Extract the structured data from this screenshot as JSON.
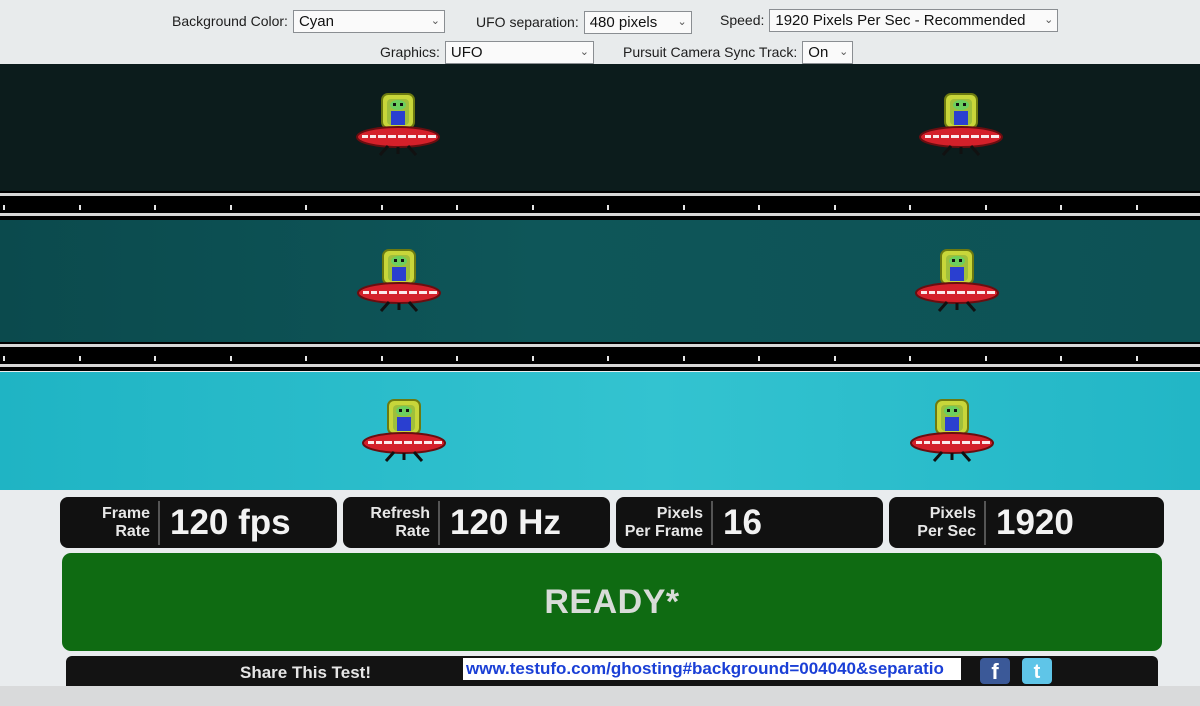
{
  "controls": {
    "background_color": {
      "label": "Background Color:",
      "value": "Cyan"
    },
    "ufo_separation": {
      "label": "UFO separation:",
      "value": "480 pixels"
    },
    "speed": {
      "label": "Speed:",
      "value": "1920 Pixels Per Sec - Recommended"
    },
    "graphics": {
      "label": "Graphics:",
      "value": "UFO"
    },
    "pursuit_camera": {
      "label": "Pursuit Camera Sync Track:",
      "value": "On"
    },
    "chevron_icon": "chevron-down-icon"
  },
  "lanes": [
    {
      "name": "dark",
      "color": "#0c1c1c"
    },
    {
      "name": "medium",
      "color": "#0e5659"
    },
    {
      "name": "light",
      "color": "#33c3d0"
    }
  ],
  "readouts": {
    "frame_rate": {
      "label_line1": "Frame",
      "label_line2": "Rate",
      "value": "120 fps"
    },
    "refresh_rate": {
      "label_line1": "Refresh",
      "label_line2": "Rate",
      "value": "120 Hz"
    },
    "pixels_per_frame": {
      "label_line1": "Pixels",
      "label_line2": "Per Frame",
      "value": "16"
    },
    "pixels_per_sec": {
      "label_line1": "Pixels",
      "label_line2": "Per Sec",
      "value": "1920"
    }
  },
  "status": {
    "text": "READY*",
    "color": "#0f6b12"
  },
  "share": {
    "label": "Share This Test!",
    "url": "www.testufo.com/ghosting#background=004040&separatio",
    "facebook_icon": "facebook-icon",
    "twitter_icon": "twitter-icon"
  }
}
